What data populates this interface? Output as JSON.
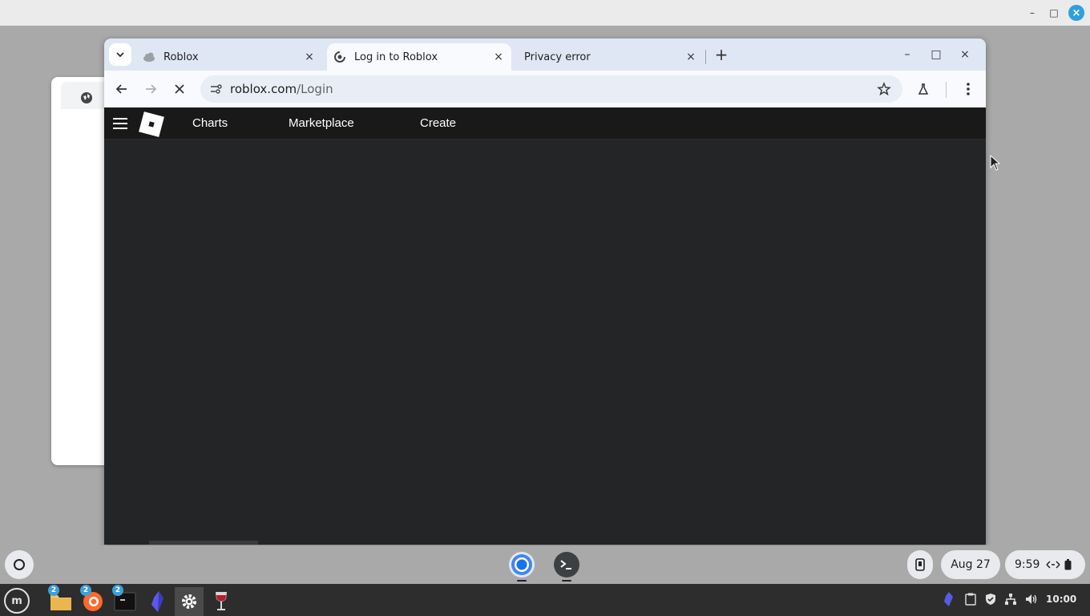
{
  "outer_window": {
    "controls": {
      "minimize": "–",
      "maximize": "□",
      "close": "×"
    }
  },
  "browser": {
    "tabs": [
      {
        "title": "Roblox",
        "active": false,
        "close": "×"
      },
      {
        "title": "Log in to Roblox",
        "active": true,
        "close": "×"
      },
      {
        "title": "Privacy error",
        "active": false,
        "close": "×"
      }
    ],
    "new_tab": "+",
    "window_controls": {
      "minimize": "–",
      "maximize": "□",
      "close": "×"
    },
    "address": {
      "domain": "roblox.com",
      "path": "/Login"
    }
  },
  "page": {
    "nav": [
      "Charts",
      "Marketplace",
      "Create"
    ]
  },
  "shelf": {
    "date": "Aug 27",
    "time": "9:59"
  },
  "taskbar": {
    "mint_label": "m",
    "badges": [
      "2",
      "2",
      "2"
    ],
    "clock": "10:00"
  },
  "colors": {
    "roblox_header": "#191919",
    "roblox_page": "#232527",
    "tabstrip": "#dfe7f5",
    "accent_blue": "#3ea0d8"
  }
}
